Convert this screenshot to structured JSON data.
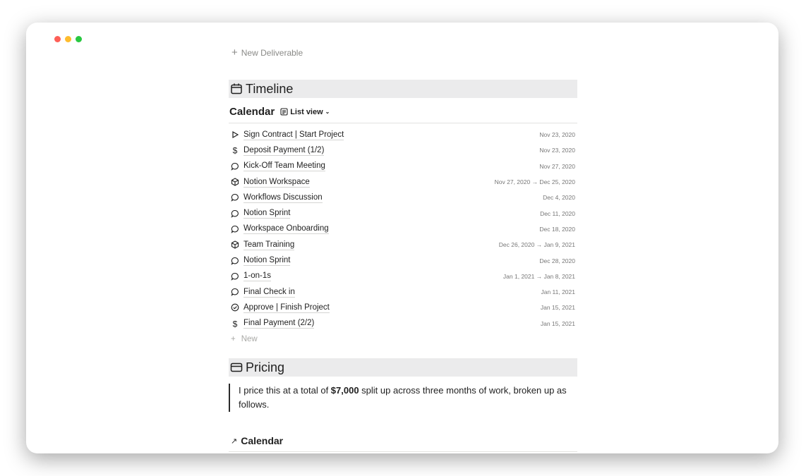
{
  "window": {
    "controls": {
      "close": "#fe5f57",
      "minimize": "#febc2e",
      "maximize": "#28c840"
    }
  },
  "new_deliverable": "New Deliverable",
  "timeline": {
    "title": "Timeline",
    "icon": "calendar-icon"
  },
  "calendar": {
    "title": "Calendar",
    "view": "List view"
  },
  "items": [
    {
      "name": "Sign Contract | Start Project",
      "date": "Nov 23, 2020",
      "icon": "play"
    },
    {
      "name": "Deposit Payment (1/2)",
      "date": "Nov 23, 2020",
      "icon": "dollar"
    },
    {
      "name": "Kick-Off Team Meeting",
      "date": "Nov 27, 2020",
      "icon": "chat"
    },
    {
      "name": "Notion Workspace",
      "date": "Nov 27, 2020 → Dec 25, 2020",
      "icon": "cube"
    },
    {
      "name": "Workflows Discussion",
      "date": "Dec 4, 2020",
      "icon": "chat"
    },
    {
      "name": "Notion Sprint",
      "date": "Dec 11, 2020",
      "icon": "chat"
    },
    {
      "name": "Workspace Onboarding",
      "date": "Dec 18, 2020",
      "icon": "chat"
    },
    {
      "name": "Team Training",
      "date": "Dec 26, 2020 → Jan 9, 2021",
      "icon": "cube"
    },
    {
      "name": "Notion Sprint",
      "date": "Dec 28, 2020",
      "icon": "chat"
    },
    {
      "name": "1-on-1s",
      "date": "Jan 1, 2021 → Jan 8, 2021",
      "icon": "chat"
    },
    {
      "name": "Final Check in",
      "date": "Jan 11, 2021",
      "icon": "chat"
    },
    {
      "name": "Approve | Finish Project",
      "date": "Jan 15, 2021",
      "icon": "check"
    },
    {
      "name": "Final Payment (2/2)",
      "date": "Jan 15, 2021",
      "icon": "dollar"
    }
  ],
  "new_label": "New",
  "pricing": {
    "title": "Pricing",
    "icon": "credit-card-icon",
    "quote_pre": "I price this at a total of ",
    "quote_bold": "$7,000",
    "quote_post": " split up across three months of work, broken up as follows."
  },
  "calendar_link": "Calendar"
}
